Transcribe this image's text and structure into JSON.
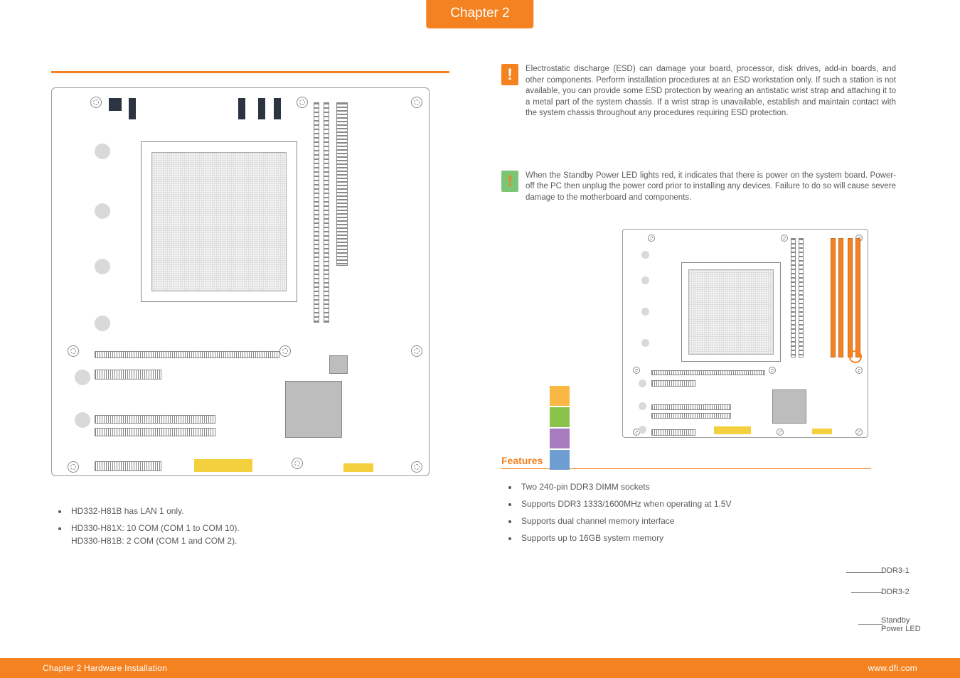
{
  "chapter_tab": "Chapter 2",
  "footer_left": "Chapter 2 Hardware Installation",
  "footer_right": "www.dfi.com",
  "left_notes": [
    "HD332-H81B has LAN 1 only.",
    "HD330-H81X: 10 COM (COM 1 to COM 10).\nHD330-H81B: 2 COM (COM 1 and COM 2)."
  ],
  "warn_esd": "Electrostatic discharge (ESD) can damage your board, processor, disk drives, add-in boards, and other components. Perform installation procedures at an ESD workstation only. If such a station is not available, you can provide some ESD protection by wearing an antistatic wrist strap and attaching it to a metal part of the system chassis. If a wrist strap is unavailable, establish and maintain contact with the system chassis throughout any procedures requiring ESD protection.",
  "warn_standby": "When the Standby Power LED lights red, it indicates that there is power on the system board. Power-off the PC then unplug the power cord prior to installing any devices. Failure to do so will cause severe damage to the motherboard and components.",
  "callouts": {
    "ddr1": "DDR3-1",
    "ddr2": "DDR3-2",
    "standby": "Standby\nPower LED"
  },
  "features_heading": "Features",
  "features": [
    "Two 240-pin DDR3 DIMM sockets",
    "Supports DDR3 1333/1600MHz when operating at 1.5V",
    "Supports dual channel memory interface",
    "Supports up to 16GB system memory"
  ]
}
